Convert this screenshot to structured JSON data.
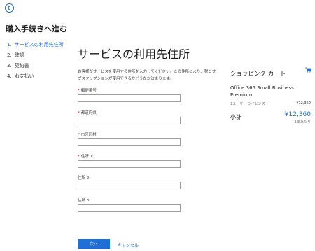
{
  "header": {
    "back_icon": "arrow-left-circle-icon",
    "title": "購入手続きへ進む"
  },
  "steps": [
    {
      "number": "1.",
      "label": "サービスの利用先住所",
      "active": true
    },
    {
      "number": "2.",
      "label": "確認",
      "active": false
    },
    {
      "number": "3.",
      "label": "契約書",
      "active": false
    },
    {
      "number": "4.",
      "label": "お支払い",
      "active": false
    }
  ],
  "main": {
    "title": "サービスの利用先住所",
    "intro": "お客様がサービスを使用する住所を入力してください。この住所により、税とサブスクリプションが使用できるかどうかが決まります。",
    "fields": [
      {
        "label": "郵便番号:",
        "required": true,
        "value": ""
      },
      {
        "label": "都道府県:",
        "required": true,
        "value": ""
      },
      {
        "label": "市区町村:",
        "required": true,
        "value": ""
      },
      {
        "label": "住所 1:",
        "required": true,
        "value": ""
      },
      {
        "label": "住所 2:",
        "required": false,
        "value": ""
      },
      {
        "label": "住所 3:",
        "required": false,
        "value": ""
      }
    ],
    "required_marker": "*",
    "next_label": "次へ",
    "cancel_label": "キャンセル"
  },
  "cart": {
    "title": "ショッピング カート",
    "cart_icon": "shopping-cart-icon",
    "product_name": "Office 365 Small Business Premium",
    "license": "1ユーザー ライセンス",
    "line_price": "¥12,360",
    "subtotal_label": "小計",
    "subtotal_value": "¥12,360",
    "per_year": "1年あたり"
  },
  "colors": {
    "accent": "#1f6fd6",
    "required": "#c8102e"
  }
}
